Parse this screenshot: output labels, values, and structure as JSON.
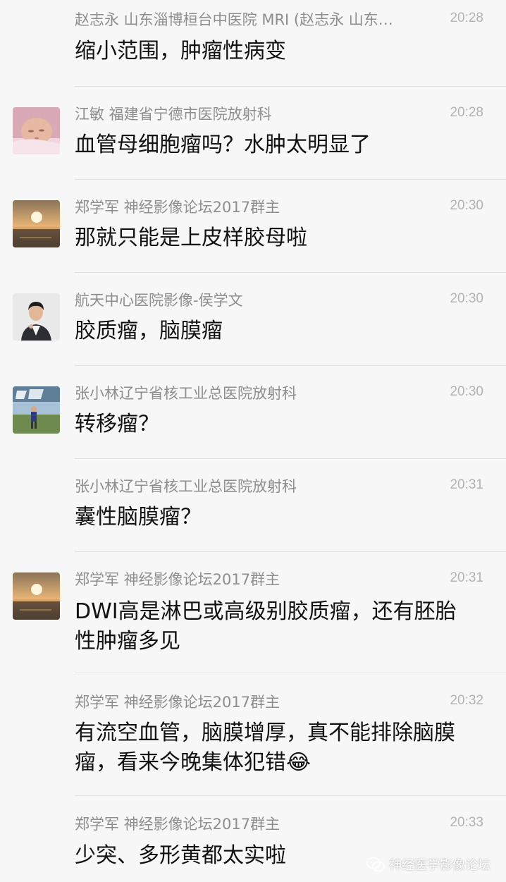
{
  "messages": [
    {
      "sender": "赵志永 山东淄博桓台中医院 MRI (赵志永 山东…",
      "time": "20:28",
      "text": "缩小范围，肿瘤性病变",
      "avatar": "none"
    },
    {
      "sender": "江敏  福建省宁德市医院放射科",
      "time": "20:28",
      "text": "血管母细胞瘤吗？水肿太明显了",
      "avatar": "baby-photo"
    },
    {
      "sender": "郑学军    神经影像论坛2017群主",
      "time": "20:30",
      "text": "那就只能是上皮样胶母啦",
      "avatar": "sunset-photo"
    },
    {
      "sender": "航天中心医院影像-侯学文",
      "time": "20:30",
      "text": "胶质瘤，脑膜瘤",
      "avatar": "man-portrait"
    },
    {
      "sender": "张小林辽宁省核工业总医院放射科",
      "time": "20:30",
      "text": "转移瘤？",
      "avatar": "person-outdoor"
    },
    {
      "sender": "张小林辽宁省核工业总医院放射科",
      "time": "20:31",
      "text": "囊性脑膜瘤？",
      "avatar": "none"
    },
    {
      "sender": "郑学军    神经影像论坛2017群主",
      "time": "20:31",
      "text": "DWI高是淋巴或高级别胶质瘤，还有胚胎性肿瘤多见",
      "avatar": "sunset-photo"
    },
    {
      "sender": "郑学军    神经影像论坛2017群主",
      "time": "20:32",
      "text": "有流空血管，脑膜增厚，真不能排除脑膜瘤，看来今晚集体犯错😂",
      "avatar": "none"
    },
    {
      "sender": "郑学军    神经影像论坛2017群主",
      "time": "20:33",
      "text": "少突、多形黄都太实啦",
      "avatar": "none"
    }
  ],
  "watermark": {
    "icon": "wechat-icon",
    "label": "神经医学影像论坛"
  }
}
